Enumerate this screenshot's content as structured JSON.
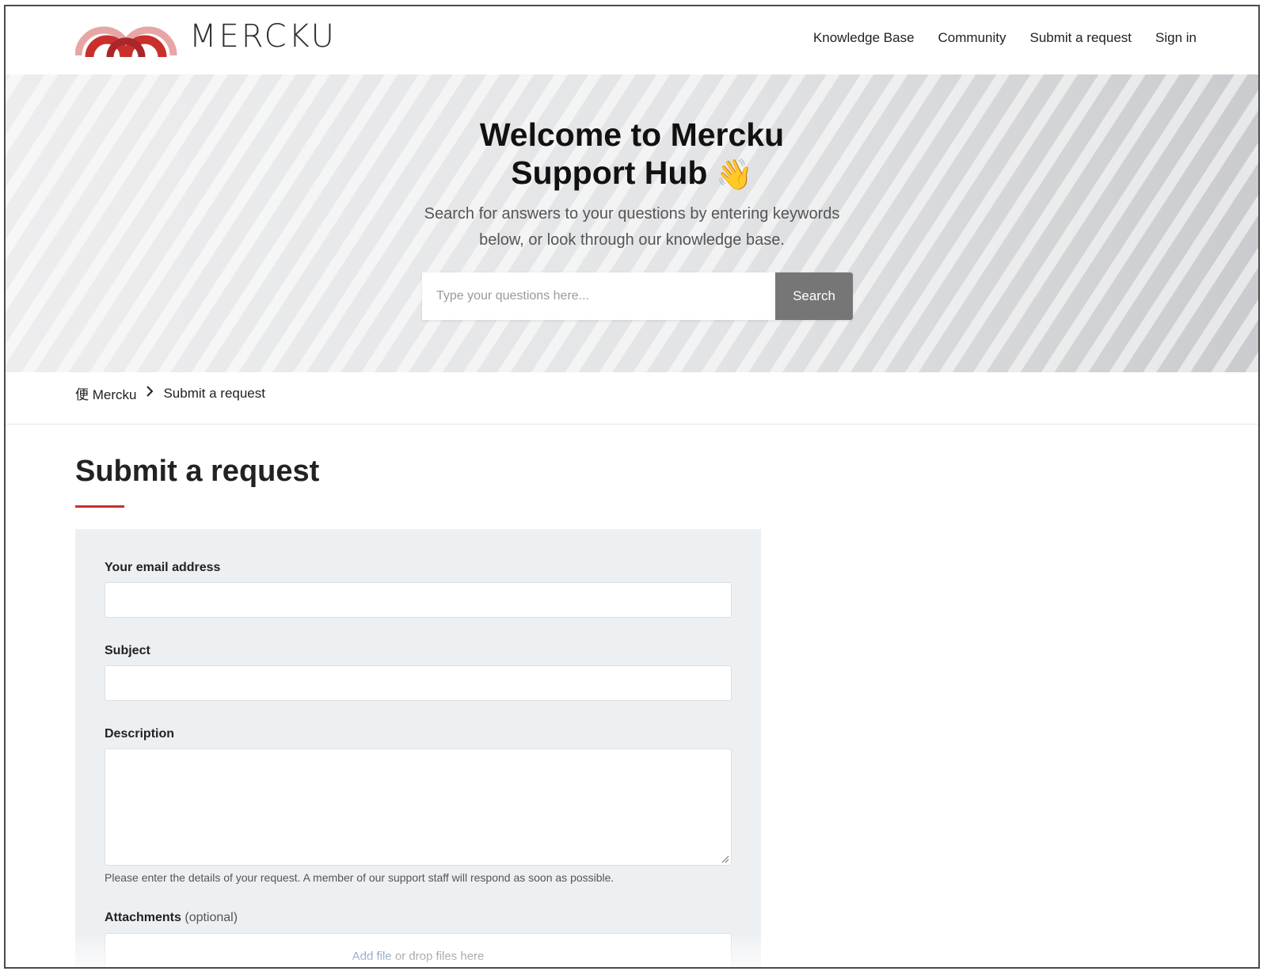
{
  "brand": {
    "logo_icon": "mercku-arches-logo",
    "logo_text": "MERCKU",
    "accent_color": "#c9302c"
  },
  "nav": {
    "items": [
      {
        "label": "Knowledge Base"
      },
      {
        "label": "Community"
      },
      {
        "label": "Submit a request"
      },
      {
        "label": "Sign in"
      }
    ]
  },
  "hero": {
    "title_line1": "Welcome to Mercku",
    "title_line2": "Support Hub",
    "wave_emoji": "👋",
    "subtitle_line1": "Search for answers to your questions by entering keywords",
    "subtitle_line2": "below, or look through our knowledge base.",
    "search": {
      "placeholder": "Type your questions here...",
      "value": "",
      "button_label": "Search"
    }
  },
  "breadcrumb": {
    "items": [
      {
        "label": "便 Mercku"
      },
      {
        "label": "Submit a request"
      }
    ],
    "separator_icon": "chevron-right-icon"
  },
  "page": {
    "title": "Submit a request"
  },
  "form": {
    "email": {
      "label": "Your email address",
      "value": ""
    },
    "subject": {
      "label": "Subject",
      "value": ""
    },
    "description": {
      "label": "Description",
      "value": "",
      "help": "Please enter the details of your request. A member of our support staff will respond as soon as possible."
    },
    "attachments": {
      "label": "Attachments",
      "optional": "(optional)",
      "add_file": "Add file",
      "drop_text": "or drop files here"
    }
  }
}
